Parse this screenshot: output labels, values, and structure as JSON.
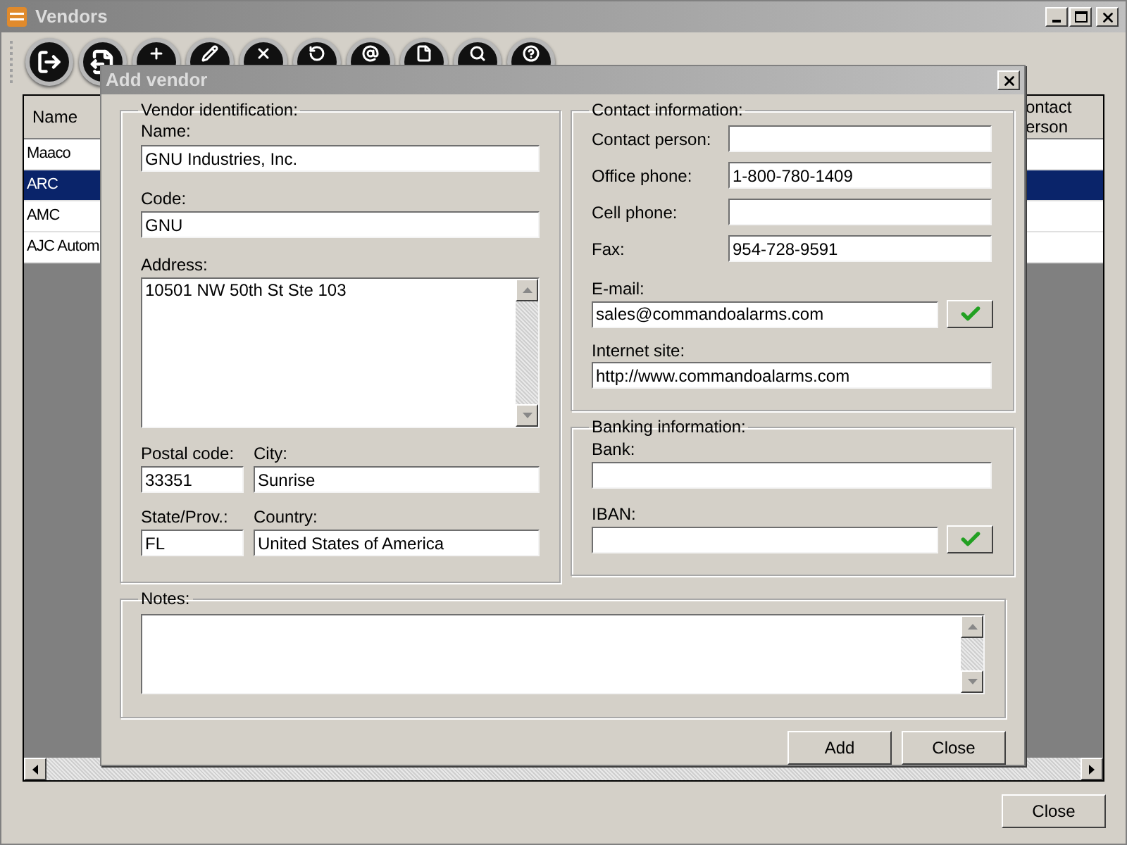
{
  "window": {
    "title": "Vendors"
  },
  "toolbar": [
    {
      "kind": "exit"
    },
    {
      "kind": "export"
    },
    {
      "kind": "add"
    },
    {
      "kind": "edit"
    },
    {
      "kind": "delete"
    },
    {
      "kind": "refresh"
    },
    {
      "kind": "email"
    },
    {
      "kind": "document"
    },
    {
      "kind": "search"
    },
    {
      "kind": "help"
    }
  ],
  "table": {
    "columns": [
      "Name",
      "ontact erson"
    ],
    "rows": [
      {
        "name": "Maaco",
        "selected": false
      },
      {
        "name": "ARC",
        "selected": true
      },
      {
        "name": "AMC",
        "selected": false
      },
      {
        "name": "AJC Autom",
        "selected": false
      }
    ]
  },
  "close_button": "Close",
  "dialog": {
    "title": "Add vendor",
    "identification": {
      "legend": "Vendor identification:",
      "name": {
        "label": "Name:",
        "value": "GNU Industries, Inc."
      },
      "code": {
        "label": "Code:",
        "value": "GNU"
      },
      "address": {
        "label": "Address:",
        "value": "10501 NW 50th St Ste 103"
      },
      "postal_code": {
        "label": "Postal code:",
        "value": "33351"
      },
      "city": {
        "label": "City:",
        "value": "Sunrise"
      },
      "state": {
        "label": "State/Prov.:",
        "value": "FL"
      },
      "country": {
        "label": "Country:",
        "value": "United States of America"
      }
    },
    "contact": {
      "legend": "Contact information:",
      "rows": [
        {
          "label": "Contact person:"
        },
        {
          "label": "Office phone:",
          "value": "1-800-780-1409"
        },
        {
          "label": "Cell phone:"
        },
        {
          "label": "Fax:",
          "value": "954-728-9591"
        }
      ],
      "email": {
        "label": "E-mail:",
        "value": "sales@commandoalarms.com"
      },
      "website": {
        "label": "Internet site:",
        "value": "http://www.commandoalarms.com"
      }
    },
    "banking": {
      "legend": "Banking information:",
      "bank": {
        "label": "Bank:"
      },
      "iban": {
        "label": "IBAN:"
      }
    },
    "notes": {
      "legend": "Notes:"
    },
    "buttons": [
      "Add",
      "Close"
    ]
  }
}
